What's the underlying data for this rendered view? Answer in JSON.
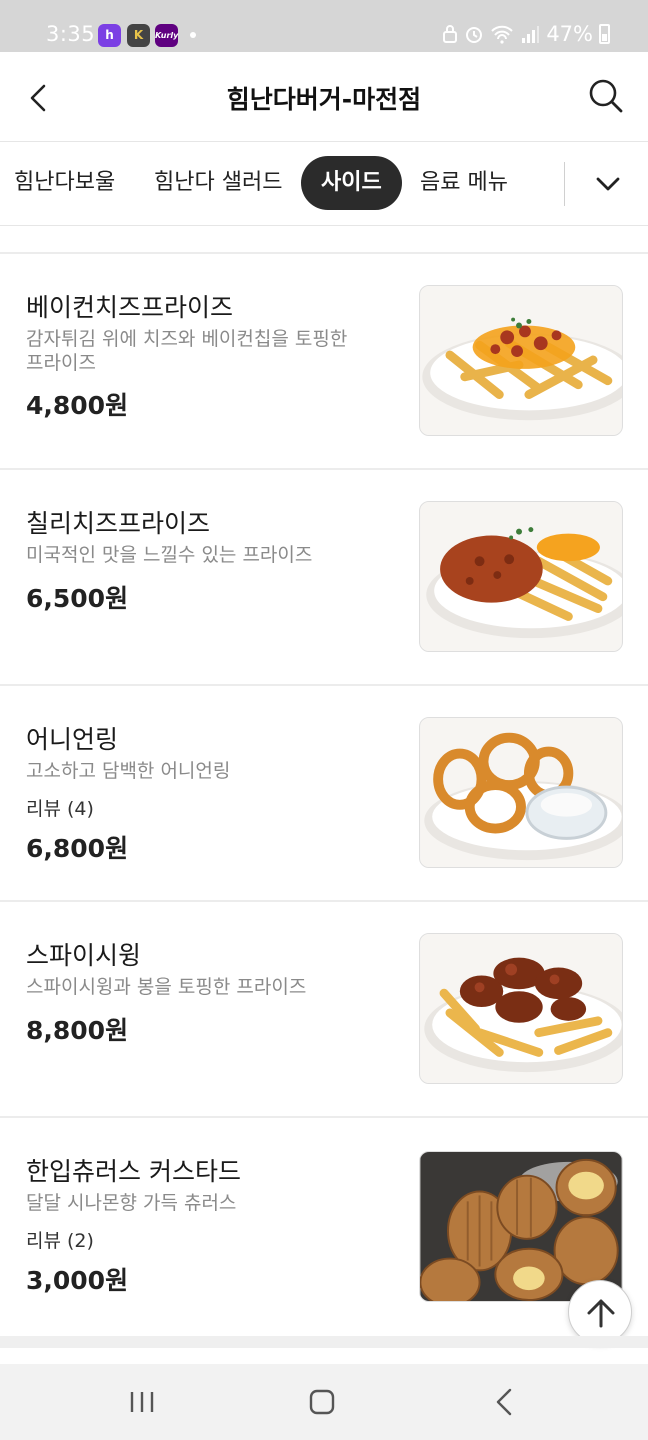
{
  "status_bar": {
    "time": "3:35",
    "battery": "47%",
    "apps": [
      "h",
      "K",
      "Kurly"
    ]
  },
  "header": {
    "title": "힘난다버거-마전점"
  },
  "tabs": [
    {
      "label": "힘난다보울",
      "active": false
    },
    {
      "label": "힘난다 샐러드",
      "active": false
    },
    {
      "label": "사이드",
      "active": true
    },
    {
      "label": "음료 메뉴",
      "active": false
    }
  ],
  "menu_items": [
    {
      "name": "베이컨치즈프라이즈",
      "description": "감자튀김 위에 치즈와 베이컨칩을 토핑한 프라이즈",
      "review": "",
      "price": "4,800원",
      "photo": "bacon-cheese-fries"
    },
    {
      "name": "칠리치즈프라이즈",
      "description": "미국적인 맛을 느낄수 있는 프라이즈",
      "review": "",
      "price": "6,500원",
      "photo": "chili-cheese-fries"
    },
    {
      "name": "어니언링",
      "description": "고소하고 담백한 어니언링",
      "review": "리뷰 (4)",
      "price": "6,800원",
      "photo": "onion-rings"
    },
    {
      "name": "스파이시윙",
      "description": "스파이시윙과 봉을 토핑한 프라이즈",
      "review": "",
      "price": "8,800원",
      "photo": "spicy-wings"
    },
    {
      "name": "한입츄러스 커스타드",
      "description": "달달 시나몬향 가득 츄러스",
      "review": "리뷰 (2)",
      "price": "3,000원",
      "photo": "custard-churros"
    }
  ],
  "colors": {
    "active_tab_bg": "#2b2b2b",
    "status_bar_bg": "#d6d6d6",
    "description_text": "#8a8a8a"
  }
}
